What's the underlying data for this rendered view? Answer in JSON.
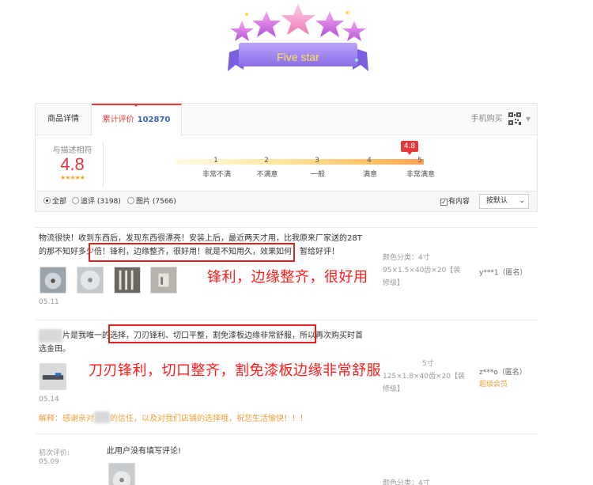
{
  "banner": {
    "title": "Five star"
  },
  "tabs": {
    "detail": "商品详情",
    "review_label": "累计评价",
    "review_count": "102870",
    "mobile": "手机购买"
  },
  "score": {
    "label": "与描述相符",
    "value": "4.8",
    "stars": "★★★★★",
    "badge": "4.8",
    "ticks": [
      "1",
      "2",
      "3",
      "4",
      "5"
    ],
    "tick_labels": [
      "非常不满",
      "不满意",
      "一般",
      "满意",
      "非常满意"
    ]
  },
  "filters": {
    "all": "全部",
    "followup": "追评 (3198)",
    "images": "图片 (7566)",
    "has_content": "有内容",
    "sort": "按默认"
  },
  "reviews": [
    {
      "line1": "物流很快！收到东西后，发现东西很漂亮！安装上后，最近两天才用，比我原来厂家送的28T",
      "line2": "的那不知好多少倍！锋利，边缘整齐，很好用！就是不知用久，效果如何！暂给好评！",
      "date": "05.11",
      "meta1": "颜色分类：4寸",
      "meta2": "95×1.5×40齿×20【装",
      "meta3": "修级】",
      "user": "y***1（匿名）",
      "callout": "锋利，边缘整齐，很好用"
    },
    {
      "line1_prefix": "片是我唯一的选择，刀刃锋利、切口平整，割免漆板边缘非常舒服，所以再次购买时首",
      "line2": "选金田。",
      "date": "05.14",
      "meta1": "5寸",
      "meta2": "125×1.8×40齿×20【装",
      "meta3": "修级】",
      "user": "z***o（匿名）",
      "vip": "超级会员",
      "callout": "刀刃锋利，切口整齐，割免漆板边缘非常舒服",
      "reply_prefix": "解释：感谢亲对",
      "reply_suffix": "的信任，以及对我们店铺的选择哦，祝您生活愉快！！！"
    },
    {
      "first_label": "初次评价:",
      "date": "05.09",
      "text": "此用户没有填写评论!",
      "meta1": "颜色分类：4寸"
    }
  ],
  "colors": {
    "accent": "#e4393c",
    "callout": "#ff1a1a",
    "star": "#f5a623",
    "reply": "#e8a03c"
  },
  "icons": {
    "qr": "qr-code-icon",
    "chevron": "chevron-down-icon",
    "star": "star-icon"
  }
}
